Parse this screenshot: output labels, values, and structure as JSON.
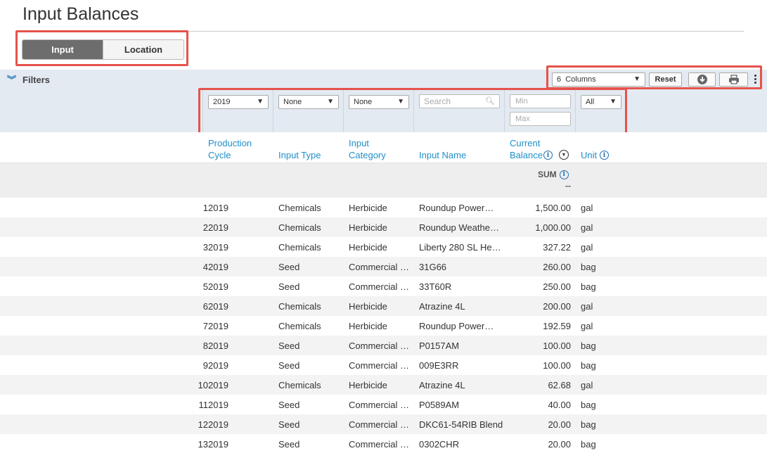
{
  "page": {
    "title": "Input Balances"
  },
  "view_toggle": {
    "input_label": "Input",
    "location_label": "Location",
    "selected": "Input"
  },
  "filters": {
    "label": "Filters",
    "production_cycle": "2019",
    "input_type": "None",
    "input_category": "None",
    "search_placeholder": "Search",
    "balance_min_placeholder": "Min",
    "balance_max_placeholder": "Max",
    "unit": "All"
  },
  "toolbar": {
    "columns_label": "6  Columns",
    "reset_label": "Reset"
  },
  "columns": {
    "production_cycle": "Production Cycle",
    "input_type": "Input Type",
    "input_category": "Input Category",
    "input_name": "Input Name",
    "current_balance": "Current Balance",
    "unit": "Unit"
  },
  "summary": {
    "label": "SUM",
    "value": "--"
  },
  "rows": [
    {
      "num": "1",
      "cycle": "2019",
      "type": "Chemicals",
      "category": "Herbicide",
      "name": "Roundup Power…",
      "balance": "1,500.00",
      "unit": "gal"
    },
    {
      "num": "2",
      "cycle": "2019",
      "type": "Chemicals",
      "category": "Herbicide",
      "name": "Roundup Weathe…",
      "balance": "1,000.00",
      "unit": "gal"
    },
    {
      "num": "3",
      "cycle": "2019",
      "type": "Chemicals",
      "category": "Herbicide",
      "name": "Liberty 280 SL He…",
      "balance": "327.22",
      "unit": "gal"
    },
    {
      "num": "4",
      "cycle": "2019",
      "type": "Seed",
      "category": "Commercial …",
      "name": "31G66",
      "balance": "260.00",
      "unit": "bag"
    },
    {
      "num": "5",
      "cycle": "2019",
      "type": "Seed",
      "category": "Commercial …",
      "name": "33T60R",
      "balance": "250.00",
      "unit": "bag"
    },
    {
      "num": "6",
      "cycle": "2019",
      "type": "Chemicals",
      "category": "Herbicide",
      "name": "Atrazine 4L",
      "balance": "200.00",
      "unit": "gal"
    },
    {
      "num": "7",
      "cycle": "2019",
      "type": "Chemicals",
      "category": "Herbicide",
      "name": "Roundup Power…",
      "balance": "192.59",
      "unit": "gal"
    },
    {
      "num": "8",
      "cycle": "2019",
      "type": "Seed",
      "category": "Commercial …",
      "name": "P0157AM",
      "balance": "100.00",
      "unit": "bag"
    },
    {
      "num": "9",
      "cycle": "2019",
      "type": "Seed",
      "category": "Commercial …",
      "name": "009E3RR",
      "balance": "100.00",
      "unit": "bag"
    },
    {
      "num": "10",
      "cycle": "2019",
      "type": "Chemicals",
      "category": "Herbicide",
      "name": "Atrazine 4L",
      "balance": "62.68",
      "unit": "gal"
    },
    {
      "num": "11",
      "cycle": "2019",
      "type": "Seed",
      "category": "Commercial …",
      "name": "P0589AM",
      "balance": "40.00",
      "unit": "bag"
    },
    {
      "num": "12",
      "cycle": "2019",
      "type": "Seed",
      "category": "Commercial …",
      "name": "DKC61-54RIB Blend",
      "balance": "20.00",
      "unit": "bag"
    },
    {
      "num": "13",
      "cycle": "2019",
      "type": "Seed",
      "category": "Commercial …",
      "name": "0302CHR",
      "balance": "20.00",
      "unit": "bag"
    }
  ],
  "colors": {
    "accent": "#1f8fc7",
    "highlight": "#e5534b",
    "filter_band": "#e3eaf2"
  },
  "icons": [
    "double-chevron-down-icon",
    "dropdown-arrow-icon",
    "search-icon",
    "info-icon",
    "sort-icon",
    "download-icon",
    "print-icon",
    "kebab-menu-icon"
  ]
}
